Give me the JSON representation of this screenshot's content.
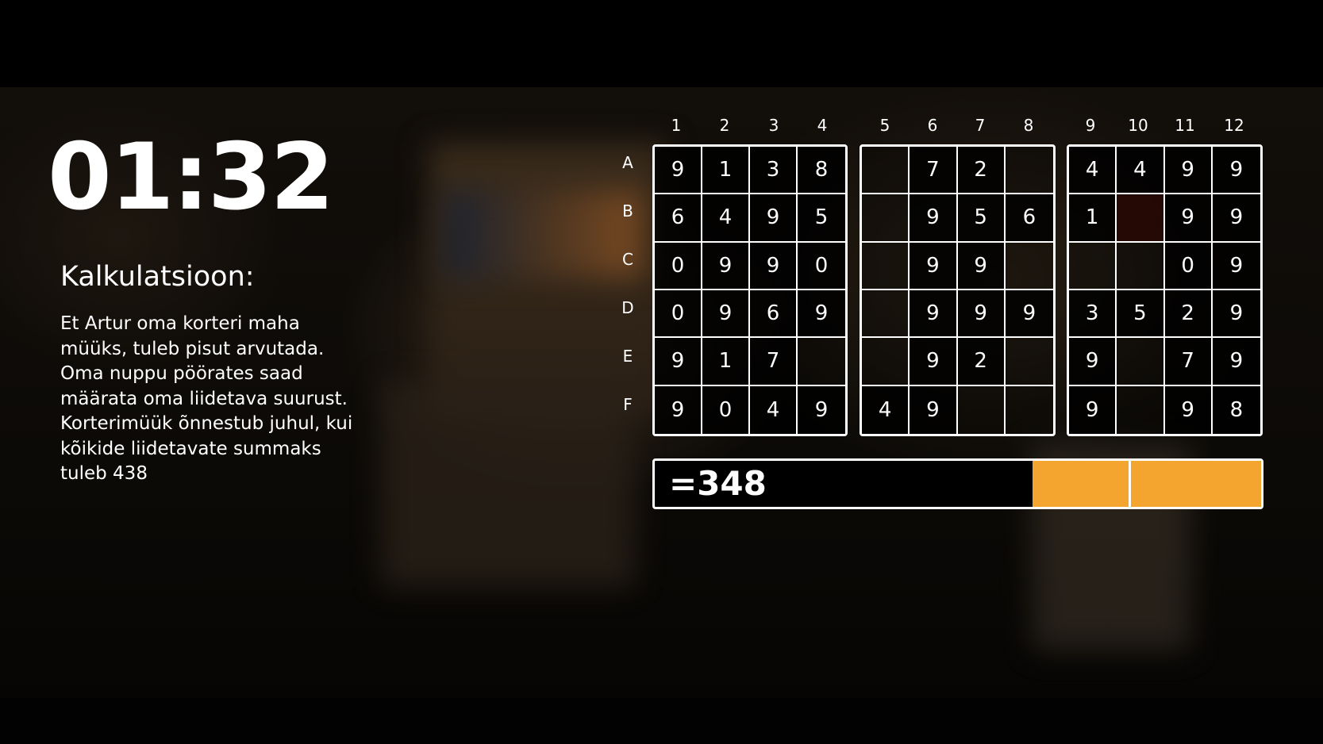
{
  "timer": "01:32",
  "panel": {
    "title": "Kalkulatsioon:",
    "description": "Et Artur oma korteri maha\nmüüks, tuleb pisut arvutada.\nOma nuppu pöörates saad\nmäärata oma liidetava suurust.\nKorterimüük õnnestub juhul, kui\nkõikide liidetavate summaks\ntuleb 438"
  },
  "columns": [
    "1",
    "2",
    "3",
    "4",
    "5",
    "6",
    "7",
    "8",
    "9",
    "10",
    "11",
    "12"
  ],
  "rows": [
    "A",
    "B",
    "C",
    "D",
    "E",
    "F"
  ],
  "blocks": [
    {
      "cells": [
        [
          "9",
          "1",
          "3",
          "8"
        ],
        [
          "6",
          "4",
          "9",
          "5"
        ],
        [
          "0",
          "9",
          "9",
          "0"
        ],
        [
          "0",
          "9",
          "6",
          "9"
        ],
        [
          "9",
          "1",
          "7",
          ""
        ],
        [
          "9",
          "0",
          "4",
          "9"
        ]
      ]
    },
    {
      "cells": [
        [
          "",
          "7",
          "2",
          ""
        ],
        [
          "",
          "9",
          "5",
          "6"
        ],
        [
          "",
          "9",
          "9",
          ""
        ],
        [
          "",
          "9",
          "9",
          "9"
        ],
        [
          "",
          "9",
          "2",
          ""
        ],
        [
          "4",
          "9",
          "",
          ""
        ]
      ]
    },
    {
      "cells": [
        [
          "4",
          "4",
          "9",
          "9"
        ],
        [
          "1",
          "",
          "9",
          "9"
        ],
        [
          "",
          "",
          "0",
          "9"
        ],
        [
          "3",
          "5",
          "2",
          "9"
        ],
        [
          "9",
          "",
          "7",
          "9"
        ],
        [
          "9",
          "",
          "9",
          "8"
        ]
      ]
    }
  ],
  "sum": {
    "value": "=348",
    "fill_color": "#f4a52f"
  }
}
